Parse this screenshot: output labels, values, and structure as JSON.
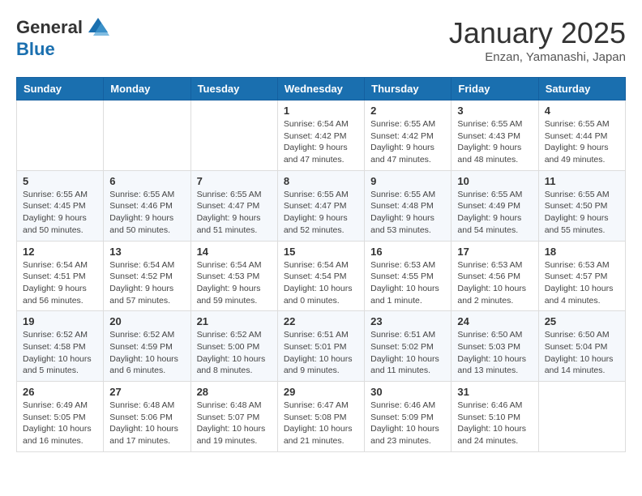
{
  "header": {
    "logo_general": "General",
    "logo_blue": "Blue",
    "month_title": "January 2025",
    "subtitle": "Enzan, Yamanashi, Japan"
  },
  "days_of_week": [
    "Sunday",
    "Monday",
    "Tuesday",
    "Wednesday",
    "Thursday",
    "Friday",
    "Saturday"
  ],
  "weeks": [
    [
      {
        "day": "",
        "info": ""
      },
      {
        "day": "",
        "info": ""
      },
      {
        "day": "",
        "info": ""
      },
      {
        "day": "1",
        "info": "Sunrise: 6:54 AM\nSunset: 4:42 PM\nDaylight: 9 hours\nand 47 minutes."
      },
      {
        "day": "2",
        "info": "Sunrise: 6:55 AM\nSunset: 4:42 PM\nDaylight: 9 hours\nand 47 minutes."
      },
      {
        "day": "3",
        "info": "Sunrise: 6:55 AM\nSunset: 4:43 PM\nDaylight: 9 hours\nand 48 minutes."
      },
      {
        "day": "4",
        "info": "Sunrise: 6:55 AM\nSunset: 4:44 PM\nDaylight: 9 hours\nand 49 minutes."
      }
    ],
    [
      {
        "day": "5",
        "info": "Sunrise: 6:55 AM\nSunset: 4:45 PM\nDaylight: 9 hours\nand 50 minutes."
      },
      {
        "day": "6",
        "info": "Sunrise: 6:55 AM\nSunset: 4:46 PM\nDaylight: 9 hours\nand 50 minutes."
      },
      {
        "day": "7",
        "info": "Sunrise: 6:55 AM\nSunset: 4:47 PM\nDaylight: 9 hours\nand 51 minutes."
      },
      {
        "day": "8",
        "info": "Sunrise: 6:55 AM\nSunset: 4:47 PM\nDaylight: 9 hours\nand 52 minutes."
      },
      {
        "day": "9",
        "info": "Sunrise: 6:55 AM\nSunset: 4:48 PM\nDaylight: 9 hours\nand 53 minutes."
      },
      {
        "day": "10",
        "info": "Sunrise: 6:55 AM\nSunset: 4:49 PM\nDaylight: 9 hours\nand 54 minutes."
      },
      {
        "day": "11",
        "info": "Sunrise: 6:55 AM\nSunset: 4:50 PM\nDaylight: 9 hours\nand 55 minutes."
      }
    ],
    [
      {
        "day": "12",
        "info": "Sunrise: 6:54 AM\nSunset: 4:51 PM\nDaylight: 9 hours\nand 56 minutes."
      },
      {
        "day": "13",
        "info": "Sunrise: 6:54 AM\nSunset: 4:52 PM\nDaylight: 9 hours\nand 57 minutes."
      },
      {
        "day": "14",
        "info": "Sunrise: 6:54 AM\nSunset: 4:53 PM\nDaylight: 9 hours\nand 59 minutes."
      },
      {
        "day": "15",
        "info": "Sunrise: 6:54 AM\nSunset: 4:54 PM\nDaylight: 10 hours\nand 0 minutes."
      },
      {
        "day": "16",
        "info": "Sunrise: 6:53 AM\nSunset: 4:55 PM\nDaylight: 10 hours\nand 1 minute."
      },
      {
        "day": "17",
        "info": "Sunrise: 6:53 AM\nSunset: 4:56 PM\nDaylight: 10 hours\nand 2 minutes."
      },
      {
        "day": "18",
        "info": "Sunrise: 6:53 AM\nSunset: 4:57 PM\nDaylight: 10 hours\nand 4 minutes."
      }
    ],
    [
      {
        "day": "19",
        "info": "Sunrise: 6:52 AM\nSunset: 4:58 PM\nDaylight: 10 hours\nand 5 minutes."
      },
      {
        "day": "20",
        "info": "Sunrise: 6:52 AM\nSunset: 4:59 PM\nDaylight: 10 hours\nand 6 minutes."
      },
      {
        "day": "21",
        "info": "Sunrise: 6:52 AM\nSunset: 5:00 PM\nDaylight: 10 hours\nand 8 minutes."
      },
      {
        "day": "22",
        "info": "Sunrise: 6:51 AM\nSunset: 5:01 PM\nDaylight: 10 hours\nand 9 minutes."
      },
      {
        "day": "23",
        "info": "Sunrise: 6:51 AM\nSunset: 5:02 PM\nDaylight: 10 hours\nand 11 minutes."
      },
      {
        "day": "24",
        "info": "Sunrise: 6:50 AM\nSunset: 5:03 PM\nDaylight: 10 hours\nand 13 minutes."
      },
      {
        "day": "25",
        "info": "Sunrise: 6:50 AM\nSunset: 5:04 PM\nDaylight: 10 hours\nand 14 minutes."
      }
    ],
    [
      {
        "day": "26",
        "info": "Sunrise: 6:49 AM\nSunset: 5:05 PM\nDaylight: 10 hours\nand 16 minutes."
      },
      {
        "day": "27",
        "info": "Sunrise: 6:48 AM\nSunset: 5:06 PM\nDaylight: 10 hours\nand 17 minutes."
      },
      {
        "day": "28",
        "info": "Sunrise: 6:48 AM\nSunset: 5:07 PM\nDaylight: 10 hours\nand 19 minutes."
      },
      {
        "day": "29",
        "info": "Sunrise: 6:47 AM\nSunset: 5:08 PM\nDaylight: 10 hours\nand 21 minutes."
      },
      {
        "day": "30",
        "info": "Sunrise: 6:46 AM\nSunset: 5:09 PM\nDaylight: 10 hours\nand 23 minutes."
      },
      {
        "day": "31",
        "info": "Sunrise: 6:46 AM\nSunset: 5:10 PM\nDaylight: 10 hours\nand 24 minutes."
      },
      {
        "day": "",
        "info": ""
      }
    ]
  ]
}
